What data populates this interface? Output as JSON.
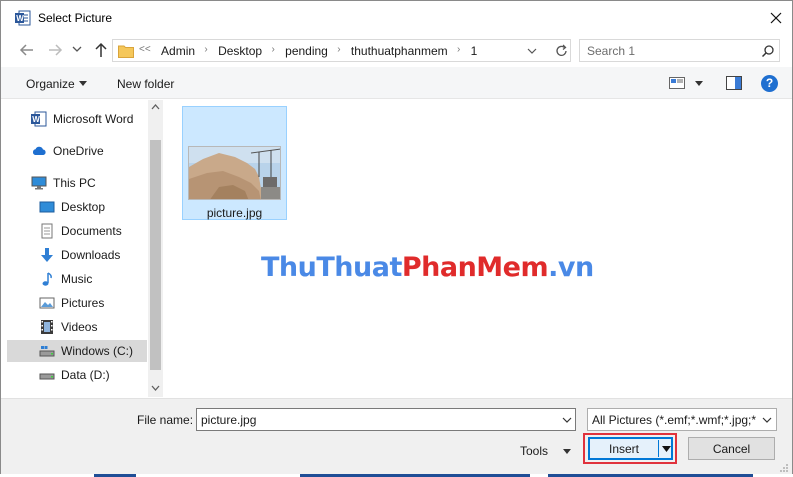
{
  "window": {
    "title": "Select Picture",
    "app_icon": "word-icon"
  },
  "nav": {
    "back_icon": "arrow-left-icon",
    "forward_icon": "arrow-right-icon",
    "recent_icon": "chevron-down-icon",
    "up_icon": "arrow-up-icon",
    "breadcrumbs": [
      "Admin",
      "Desktop",
      "pending",
      "thuthuatphanmem",
      "1"
    ],
    "overflow": "<<",
    "search_placeholder": "Search 1"
  },
  "toolbar": {
    "organize_label": "Organize",
    "new_folder_label": "New folder",
    "help_label": "?"
  },
  "sidebar": {
    "items": [
      {
        "label": "Microsoft Word",
        "icon": "word-icon"
      },
      {
        "label": "OneDrive",
        "icon": "cloud-icon"
      },
      {
        "label": "This PC",
        "icon": "computer-icon"
      },
      {
        "label": "Desktop",
        "icon": "desktop-icon"
      },
      {
        "label": "Documents",
        "icon": "documents-icon"
      },
      {
        "label": "Downloads",
        "icon": "download-icon"
      },
      {
        "label": "Music",
        "icon": "music-icon"
      },
      {
        "label": "Pictures",
        "icon": "pictures-icon"
      },
      {
        "label": "Videos",
        "icon": "videos-icon"
      },
      {
        "label": "Windows (C:)",
        "icon": "drive-icon",
        "selected": true
      },
      {
        "label": "Data (D:)",
        "icon": "drive-icon"
      }
    ]
  },
  "files": [
    {
      "name": "picture.jpg",
      "selected": true
    }
  ],
  "watermark": {
    "part1": "ThuThuat",
    "part2": "PhanMem",
    "part3": ".vn"
  },
  "footer": {
    "file_name_label": "File name:",
    "file_name_value": "picture.jpg",
    "filter_value": "All Pictures (*.emf;*.wmf;*.jpg;*",
    "tools_label": "Tools",
    "insert_label": "Insert",
    "cancel_label": "Cancel"
  },
  "colors": {
    "accent": "#0078d7",
    "highlight": "#e0323c",
    "selection": "#cce8ff"
  }
}
